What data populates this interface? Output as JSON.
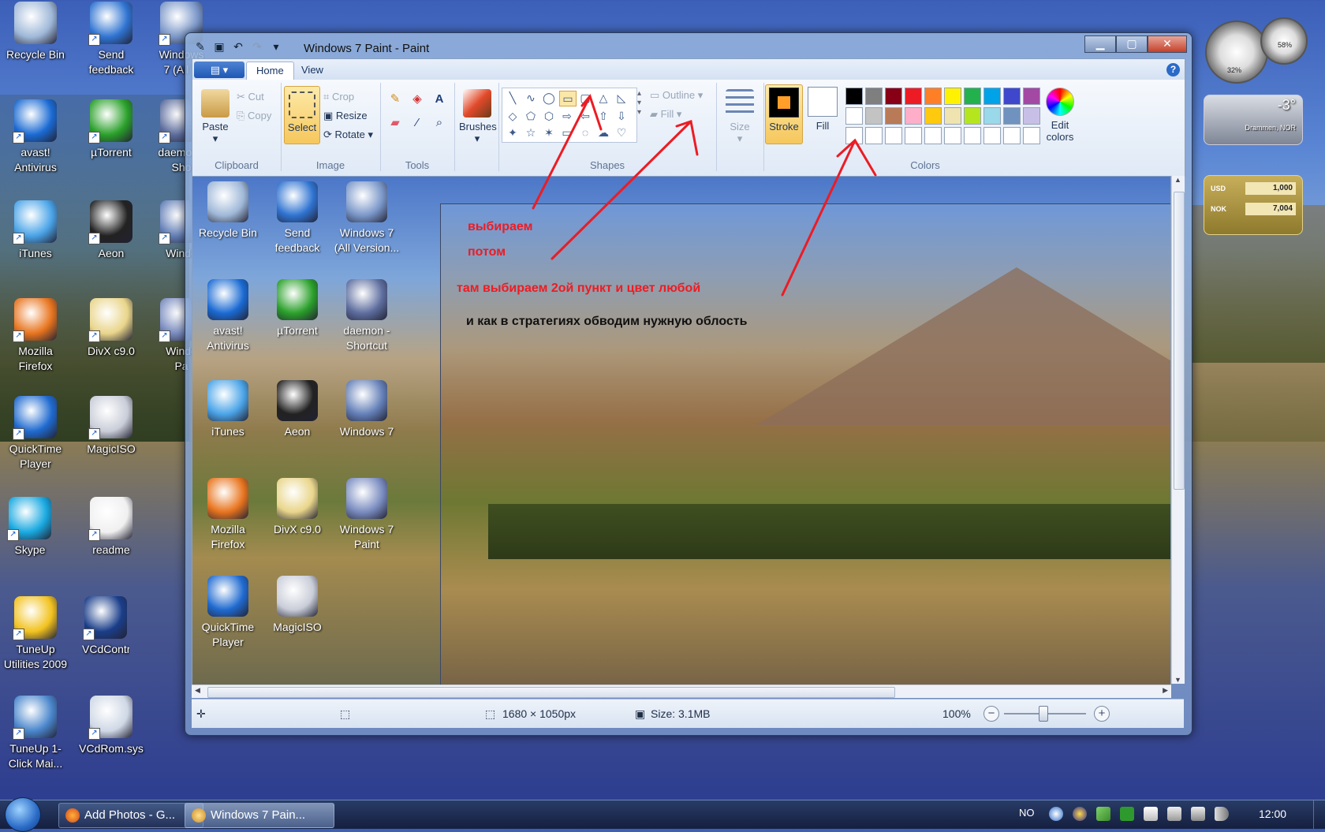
{
  "desktop_icons": [
    {
      "label": "Recycle Bin"
    },
    {
      "label": "Send feedback"
    },
    {
      "label": "Windows 7 (All V"
    },
    {
      "label": "avast! Antivirus"
    },
    {
      "label": "µTorrent"
    },
    {
      "label": "daemon - Sho"
    },
    {
      "label": "iTunes"
    },
    {
      "label": "Aeon"
    },
    {
      "label": "Windo"
    },
    {
      "label": "Mozilla Firefox"
    },
    {
      "label": "DivX c9.0"
    },
    {
      "label": "Windo Pa"
    },
    {
      "label": "QuickTime Player"
    },
    {
      "label": "MagicISO"
    },
    {
      "label": "Skype"
    },
    {
      "label": "readme"
    },
    {
      "label": "TuneUp Utilities 2009"
    },
    {
      "label": "VCdControl..."
    },
    {
      "label": "TuneUp 1-Click Mai..."
    },
    {
      "label": "VCdRom.sys"
    }
  ],
  "gadgets": {
    "cpu_percent": "32%",
    "mem_percent": "58%",
    "weather_temp": "-3°",
    "weather_location": "Drammen, NOR",
    "currency": [
      {
        "code": "USD",
        "value": "1,000"
      },
      {
        "code": "NOK",
        "value": "7,004"
      }
    ]
  },
  "window": {
    "title": "Windows 7 Paint - Paint",
    "tabs": [
      {
        "label": "Home",
        "active": true
      },
      {
        "label": "View",
        "active": false
      }
    ],
    "clipboard": {
      "paste": "Paste",
      "cut": "Cut",
      "copy": "Copy",
      "group": "Clipboard"
    },
    "image": {
      "select": "Select",
      "crop": "Crop",
      "resize": "Resize",
      "rotate": "Rotate",
      "group": "Image"
    },
    "tools": {
      "group": "Tools"
    },
    "brushes": {
      "label": "Brushes"
    },
    "shapes": {
      "outline": "Outline",
      "fill": "Fill",
      "group": "Shapes"
    },
    "size": {
      "label": "Size"
    },
    "colors": {
      "stroke": "Stroke",
      "fill": "Fill",
      "edit": "Edit colors",
      "group": "Colors",
      "palette": [
        "#000000",
        "#7f7f7f",
        "#880015",
        "#ed1c24",
        "#ff7f27",
        "#fff200",
        "#22b14c",
        "#00a2e8",
        "#3f48cc",
        "#a349a4",
        "#ffffff",
        "#c3c3c3",
        "#b97a57",
        "#ffaec9",
        "#ffc90e",
        "#efe4b0",
        "#b5e61d",
        "#99d9ea",
        "#7092be",
        "#c8bfe7",
        "#ffffff",
        "#ffffff",
        "#ffffff",
        "#ffffff",
        "#ffffff",
        "#ffffff",
        "#ffffff",
        "#ffffff",
        "#ffffff",
        "#ffffff"
      ]
    },
    "status": {
      "dimensions": "1680 × 1050px",
      "size": "Size: 3.1MB",
      "zoom": "100%"
    }
  },
  "canvas_icons": [
    {
      "label": "Recycle Bin"
    },
    {
      "label": "Send feedback"
    },
    {
      "label": "Windows 7 (All Version..."
    },
    {
      "label": "avast! Antivirus"
    },
    {
      "label": "µTorrent"
    },
    {
      "label": "daemon - Shortcut"
    },
    {
      "label": "iTunes"
    },
    {
      "label": "Aeon"
    },
    {
      "label": "Windows 7"
    },
    {
      "label": "Mozilla Firefox"
    },
    {
      "label": "DivX c9.0"
    },
    {
      "label": "Windows 7 Paint"
    },
    {
      "label": "QuickTime Player"
    },
    {
      "label": "MagicISO"
    }
  ],
  "annotations": [
    {
      "text": "выбираем",
      "color": "red"
    },
    {
      "text": "потом",
      "color": "red"
    },
    {
      "text": "там выбираем 2ой пункт  и цвет любой",
      "color": "red"
    },
    {
      "text": "и как в стратегиях обводим нужную облость",
      "color": "black"
    }
  ],
  "taskbar": {
    "items": [
      {
        "label": "Add Photos - G...",
        "active": false
      },
      {
        "label": "Windows 7 Pain...",
        "active": true
      }
    ],
    "lang": "NO",
    "clock": "12:00"
  }
}
